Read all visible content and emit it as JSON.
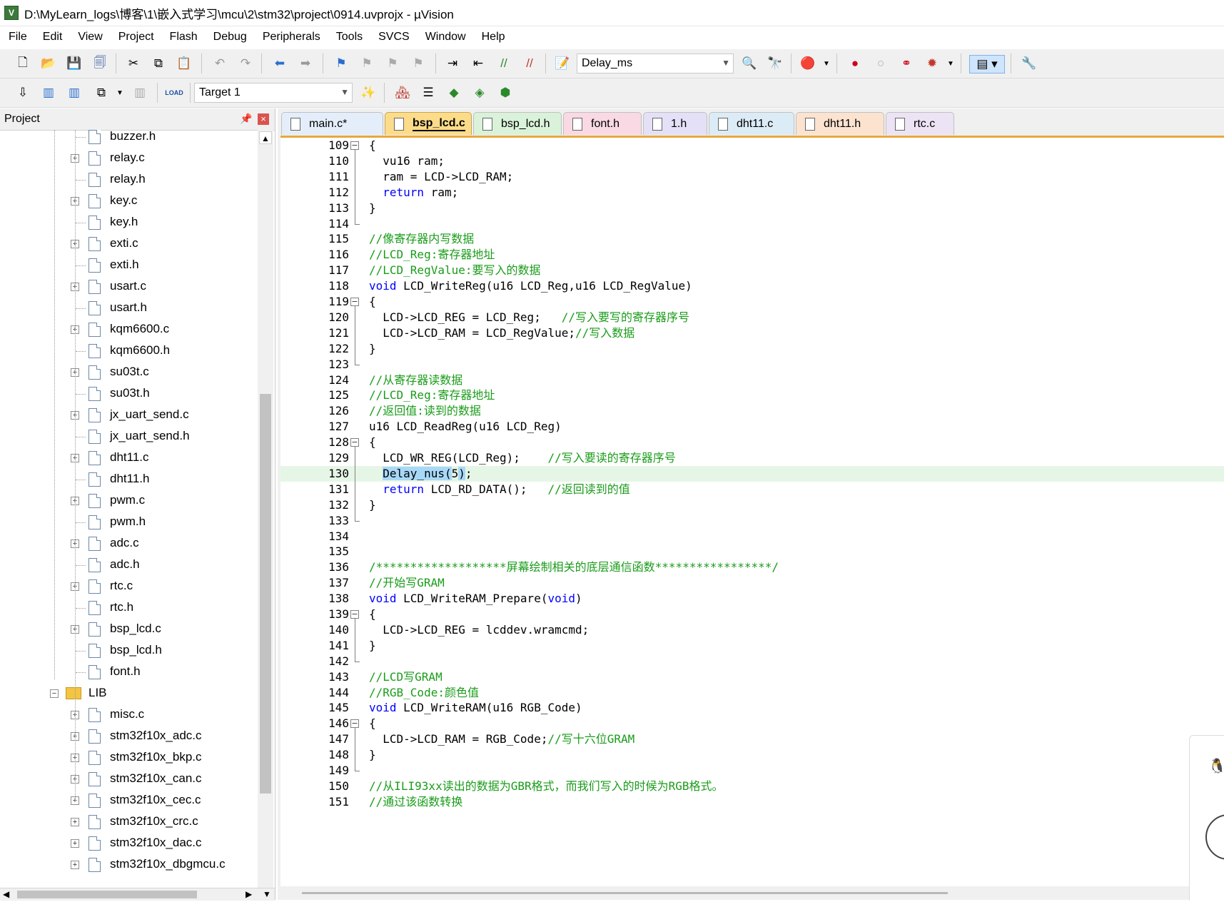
{
  "window": {
    "title": "D:\\MyLearn_logs\\博客\\1\\嵌入式学习\\mcu\\2\\stm32\\project\\0914.uvprojx - µVision",
    "app_icon_letter": "V"
  },
  "menu": [
    "File",
    "Edit",
    "View",
    "Project",
    "Flash",
    "Debug",
    "Peripherals",
    "Tools",
    "SVCS",
    "Window",
    "Help"
  ],
  "toolbar": {
    "function_combo": "Delay_ms",
    "target_combo": "Target 1",
    "load_label": "LOAD"
  },
  "project_panel": {
    "title": "Project",
    "items": [
      {
        "label": "buzzer.h",
        "type": "file",
        "expandable": false
      },
      {
        "label": "relay.c",
        "type": "file",
        "expandable": true
      },
      {
        "label": "relay.h",
        "type": "file",
        "expandable": false
      },
      {
        "label": "key.c",
        "type": "file",
        "expandable": true
      },
      {
        "label": "key.h",
        "type": "file",
        "expandable": false
      },
      {
        "label": "exti.c",
        "type": "file",
        "expandable": true
      },
      {
        "label": "exti.h",
        "type": "file",
        "expandable": false
      },
      {
        "label": "usart.c",
        "type": "file",
        "expandable": true
      },
      {
        "label": "usart.h",
        "type": "file",
        "expandable": false
      },
      {
        "label": "kqm6600.c",
        "type": "file",
        "expandable": true
      },
      {
        "label": "kqm6600.h",
        "type": "file",
        "expandable": false
      },
      {
        "label": "su03t.c",
        "type": "file",
        "expandable": true
      },
      {
        "label": "su03t.h",
        "type": "file",
        "expandable": false
      },
      {
        "label": "jx_uart_send.c",
        "type": "file",
        "expandable": true
      },
      {
        "label": "jx_uart_send.h",
        "type": "file",
        "expandable": false
      },
      {
        "label": "dht11.c",
        "type": "file",
        "expandable": true
      },
      {
        "label": "dht11.h",
        "type": "file",
        "expandable": false
      },
      {
        "label": "pwm.c",
        "type": "file",
        "expandable": true
      },
      {
        "label": "pwm.h",
        "type": "file",
        "expandable": false
      },
      {
        "label": "adc.c",
        "type": "file",
        "expandable": true
      },
      {
        "label": "adc.h",
        "type": "file",
        "expandable": false
      },
      {
        "label": "rtc.c",
        "type": "file",
        "expandable": true
      },
      {
        "label": "rtc.h",
        "type": "file",
        "expandable": false
      },
      {
        "label": "bsp_lcd.c",
        "type": "file",
        "expandable": true
      },
      {
        "label": "bsp_lcd.h",
        "type": "file",
        "expandable": false
      },
      {
        "label": "font.h",
        "type": "file",
        "expandable": false
      },
      {
        "label": "LIB",
        "type": "folder",
        "expandable": true
      },
      {
        "label": "misc.c",
        "type": "file",
        "expandable": true
      },
      {
        "label": "stm32f10x_adc.c",
        "type": "file",
        "expandable": true
      },
      {
        "label": "stm32f10x_bkp.c",
        "type": "file",
        "expandable": true
      },
      {
        "label": "stm32f10x_can.c",
        "type": "file",
        "expandable": true
      },
      {
        "label": "stm32f10x_cec.c",
        "type": "file",
        "expandable": true
      },
      {
        "label": "stm32f10x_crc.c",
        "type": "file",
        "expandable": true
      },
      {
        "label": "stm32f10x_dac.c",
        "type": "file",
        "expandable": true
      },
      {
        "label": "stm32f10x_dbgmcu.c",
        "type": "file",
        "expandable": true
      }
    ]
  },
  "tabs": [
    {
      "label": "main.c*",
      "color": "#e4eefb",
      "active": false
    },
    {
      "label": "bsp_lcd.c",
      "color": "#fcdc8a",
      "active": true
    },
    {
      "label": "bsp_lcd.h",
      "color": "#d9f2d9",
      "active": false
    },
    {
      "label": "font.h",
      "color": "#f9d9e4",
      "active": false
    },
    {
      "label": "1.h",
      "color": "#e4e0f7",
      "active": false
    },
    {
      "label": "dht11.c",
      "color": "#dcecf7",
      "active": false
    },
    {
      "label": "dht11.h",
      "color": "#fbe3d0",
      "active": false
    },
    {
      "label": "rtc.c",
      "color": "#ece4f4",
      "active": false
    }
  ],
  "code": {
    "lines": [
      {
        "n": "109",
        "fold": "open",
        "segs": [
          [
            "",
            "{"
          ]
        ]
      },
      {
        "n": "110",
        "fold": "line",
        "segs": [
          [
            "",
            "  vu16 ram;"
          ]
        ]
      },
      {
        "n": "111",
        "fold": "line",
        "segs": [
          [
            "",
            "  ram = LCD->LCD_RAM;"
          ]
        ]
      },
      {
        "n": "112",
        "fold": "line",
        "segs": [
          [
            "",
            "  "
          ],
          [
            "kw",
            "return"
          ],
          [
            "",
            " ram;"
          ]
        ]
      },
      {
        "n": "113",
        "fold": "line",
        "segs": [
          [
            "",
            "}"
          ]
        ]
      },
      {
        "n": "114",
        "fold": "end",
        "segs": [
          [
            "",
            ""
          ]
        ]
      },
      {
        "n": "115",
        "fold": "",
        "segs": [
          [
            "cm",
            "//像寄存器内写数据"
          ]
        ]
      },
      {
        "n": "116",
        "fold": "",
        "segs": [
          [
            "cm",
            "//LCD_Reg:寄存器地址"
          ]
        ]
      },
      {
        "n": "117",
        "fold": "",
        "segs": [
          [
            "cm",
            "//LCD_RegValue:要写入的数据"
          ]
        ]
      },
      {
        "n": "118",
        "fold": "",
        "segs": [
          [
            "kw",
            "void"
          ],
          [
            "",
            " LCD_WriteReg(u16 LCD_Reg,u16 LCD_RegValue)"
          ]
        ]
      },
      {
        "n": "119",
        "fold": "open",
        "segs": [
          [
            "",
            "{"
          ]
        ]
      },
      {
        "n": "120",
        "fold": "line",
        "segs": [
          [
            "",
            "  LCD->LCD_REG = LCD_Reg;   "
          ],
          [
            "cm",
            "//写入要写的寄存器序号"
          ]
        ]
      },
      {
        "n": "121",
        "fold": "line",
        "segs": [
          [
            "",
            "  LCD->LCD_RAM = LCD_RegValue;"
          ],
          [
            "cm",
            "//写入数据"
          ]
        ]
      },
      {
        "n": "122",
        "fold": "line",
        "segs": [
          [
            "",
            "}"
          ]
        ]
      },
      {
        "n": "123",
        "fold": "end",
        "segs": [
          [
            "",
            ""
          ]
        ]
      },
      {
        "n": "124",
        "fold": "",
        "segs": [
          [
            "cm",
            "//从寄存器读数据"
          ]
        ]
      },
      {
        "n": "125",
        "fold": "",
        "segs": [
          [
            "cm",
            "//LCD_Reg:寄存器地址"
          ]
        ]
      },
      {
        "n": "126",
        "fold": "",
        "segs": [
          [
            "cm",
            "//返回值:读到的数据"
          ]
        ]
      },
      {
        "n": "127",
        "fold": "",
        "segs": [
          [
            "",
            "u16 LCD_ReadReg(u16 LCD_Reg)"
          ]
        ]
      },
      {
        "n": "128",
        "fold": "open",
        "segs": [
          [
            "",
            "{"
          ]
        ]
      },
      {
        "n": "129",
        "fold": "line",
        "segs": [
          [
            "",
            "  LCD_WR_REG(LCD_Reg);    "
          ],
          [
            "cm",
            "//写入要读的寄存器序号"
          ]
        ]
      },
      {
        "n": "130",
        "fold": "line",
        "highlight": true,
        "segs": [
          [
            "",
            "  "
          ],
          [
            "sel",
            "Delay_nus("
          ],
          [
            "",
            "5"
          ],
          [
            "sel",
            ")"
          ],
          [
            "",
            ";"
          ]
        ]
      },
      {
        "n": "131",
        "fold": "line",
        "segs": [
          [
            "",
            "  "
          ],
          [
            "kw",
            "return"
          ],
          [
            "",
            " LCD_RD_DATA();   "
          ],
          [
            "cm",
            "//返回读到的值"
          ]
        ]
      },
      {
        "n": "132",
        "fold": "line",
        "segs": [
          [
            "",
            "}"
          ]
        ]
      },
      {
        "n": "133",
        "fold": "end",
        "segs": [
          [
            "",
            ""
          ]
        ]
      },
      {
        "n": "134",
        "fold": "",
        "segs": [
          [
            "",
            ""
          ]
        ]
      },
      {
        "n": "135",
        "fold": "",
        "segs": [
          [
            "",
            ""
          ]
        ]
      },
      {
        "n": "136",
        "fold": "",
        "segs": [
          [
            "cm",
            "/*******************屏幕绘制相关的底层通信函数*****************/"
          ]
        ]
      },
      {
        "n": "137",
        "fold": "",
        "segs": [
          [
            "cm",
            "//开始写GRAM"
          ]
        ]
      },
      {
        "n": "138",
        "fold": "",
        "segs": [
          [
            "kw",
            "void"
          ],
          [
            "",
            " LCD_WriteRAM_Prepare("
          ],
          [
            "kw",
            "void"
          ],
          [
            "",
            ")"
          ]
        ]
      },
      {
        "n": "139",
        "fold": "open",
        "segs": [
          [
            "",
            "{"
          ]
        ]
      },
      {
        "n": "140",
        "fold": "line",
        "segs": [
          [
            "",
            "  LCD->LCD_REG = lcddev.wramcmd;"
          ]
        ]
      },
      {
        "n": "141",
        "fold": "line",
        "segs": [
          [
            "",
            "}"
          ]
        ]
      },
      {
        "n": "142",
        "fold": "end",
        "segs": [
          [
            "",
            ""
          ]
        ]
      },
      {
        "n": "143",
        "fold": "",
        "segs": [
          [
            "cm",
            "//LCD写GRAM"
          ]
        ]
      },
      {
        "n": "144",
        "fold": "",
        "segs": [
          [
            "cm",
            "//RGB_Code:颜色值"
          ]
        ]
      },
      {
        "n": "145",
        "fold": "",
        "segs": [
          [
            "kw",
            "void"
          ],
          [
            "",
            " LCD_WriteRAM(u16 RGB_Code)"
          ]
        ]
      },
      {
        "n": "146",
        "fold": "open",
        "segs": [
          [
            "",
            "{"
          ]
        ]
      },
      {
        "n": "147",
        "fold": "line",
        "segs": [
          [
            "",
            "  LCD->LCD_RAM = RGB_Code;"
          ],
          [
            "cm",
            "//写十六位GRAM"
          ]
        ]
      },
      {
        "n": "148",
        "fold": "line",
        "segs": [
          [
            "",
            "}"
          ]
        ]
      },
      {
        "n": "149",
        "fold": "end",
        "segs": [
          [
            "",
            ""
          ]
        ]
      },
      {
        "n": "150",
        "fold": "",
        "segs": [
          [
            "cm",
            "//从ILI93xx读出的数据为GBR格式，而我们写入的时候为RGB格式。"
          ]
        ]
      },
      {
        "n": "151",
        "fold": "",
        "segs": [
          [
            "cm",
            "//通过该函数转换"
          ]
        ]
      }
    ]
  },
  "colors": {
    "keyword": "#0000ff",
    "comment": "#1a9c1a",
    "active_tab": "#fcdc8a",
    "current_line": "#e6f6e6",
    "selection": "#a8d8f8"
  }
}
